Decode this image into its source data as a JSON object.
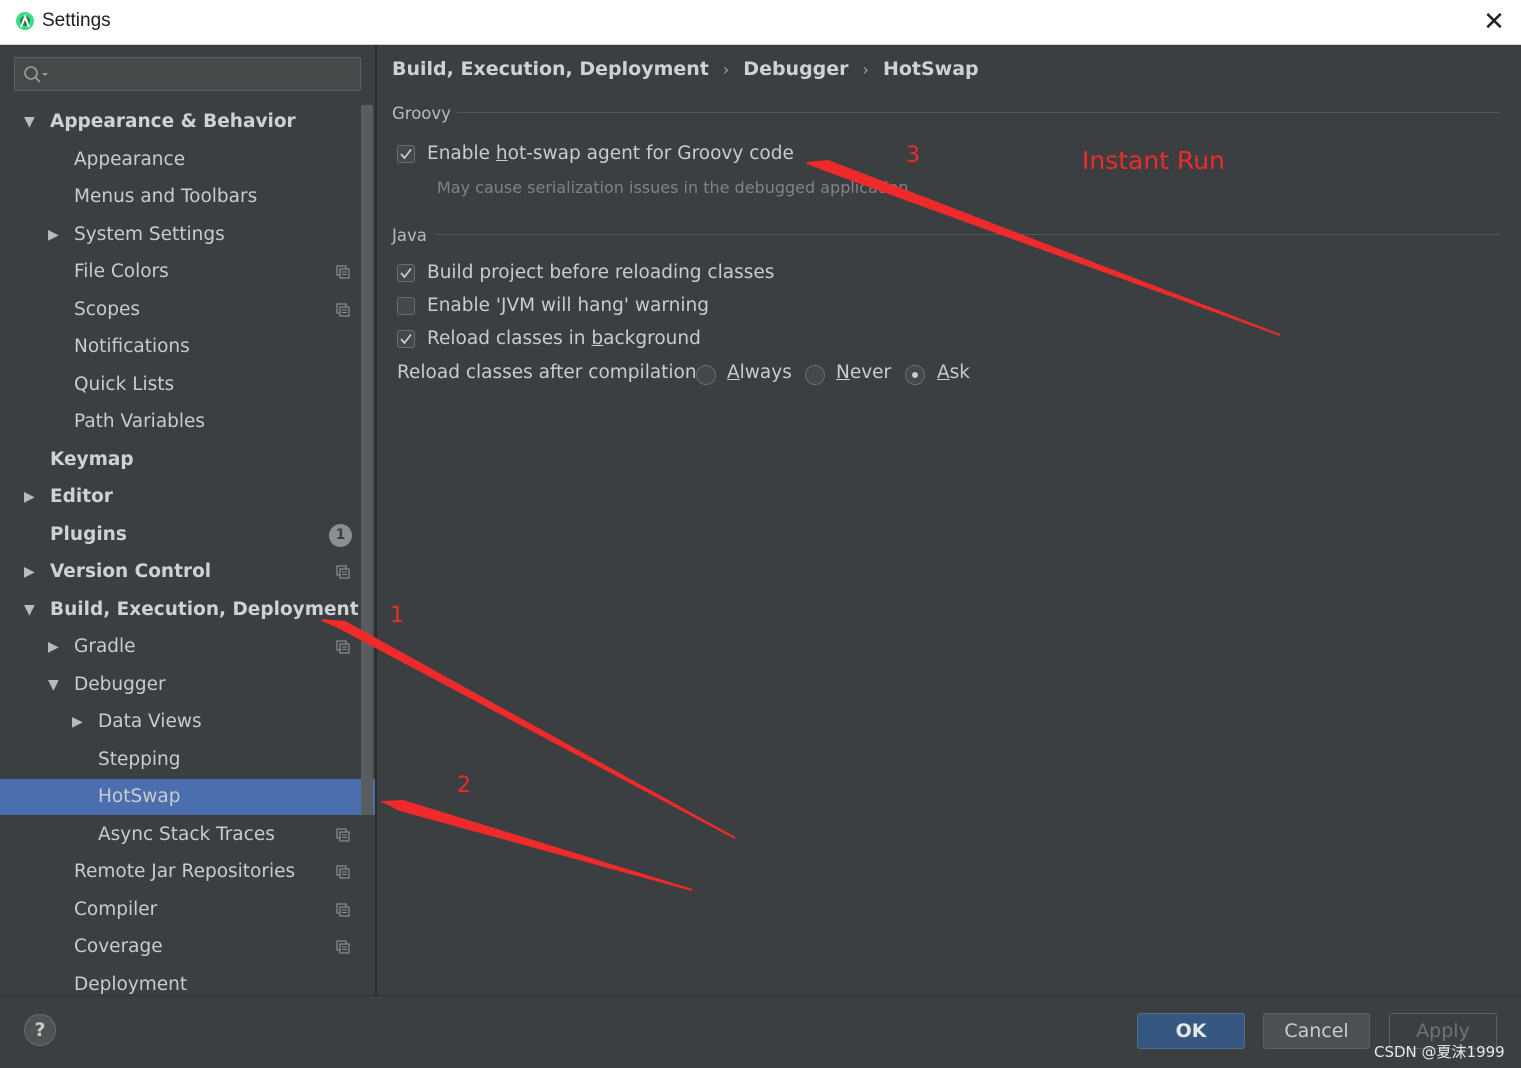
{
  "window": {
    "title": "Settings",
    "close_symbol": "✕"
  },
  "sidebar": {
    "search_placeholder": "",
    "items": [
      {
        "label": "Appearance & Behavior",
        "bold": true,
        "arrow": "down",
        "indent": 0
      },
      {
        "label": "Appearance",
        "indent": 1
      },
      {
        "label": "Menus and Toolbars",
        "indent": 1
      },
      {
        "label": "System Settings",
        "arrow": "right",
        "indent": 1
      },
      {
        "label": "File Colors",
        "indent": 1,
        "project_icon": true
      },
      {
        "label": "Scopes",
        "indent": 1,
        "project_icon": true
      },
      {
        "label": "Notifications",
        "indent": 1
      },
      {
        "label": "Quick Lists",
        "indent": 1
      },
      {
        "label": "Path Variables",
        "indent": 1
      },
      {
        "label": "Keymap",
        "bold": true,
        "indent": 0
      },
      {
        "label": "Editor",
        "bold": true,
        "arrow": "right",
        "indent": 0
      },
      {
        "label": "Plugins",
        "bold": true,
        "indent": 0,
        "badge": "1"
      },
      {
        "label": "Version Control",
        "bold": true,
        "arrow": "right",
        "indent": 0,
        "project_icon": true
      },
      {
        "label": "Build, Execution, Deployment",
        "bold": true,
        "arrow": "down",
        "indent": 0
      },
      {
        "label": "Gradle",
        "arrow": "right",
        "indent": 1,
        "project_icon": true
      },
      {
        "label": "Debugger",
        "arrow": "down",
        "indent": 1
      },
      {
        "label": "Data Views",
        "arrow": "right",
        "indent": 2
      },
      {
        "label": "Stepping",
        "indent": 2
      },
      {
        "label": "HotSwap",
        "indent": 2,
        "selected": true
      },
      {
        "label": "Async Stack Traces",
        "indent": 2,
        "project_icon": true
      },
      {
        "label": "Remote Jar Repositories",
        "indent": 1,
        "project_icon": true
      },
      {
        "label": "Compiler",
        "indent": 1,
        "project_icon": true
      },
      {
        "label": "Coverage",
        "indent": 1,
        "project_icon": true
      },
      {
        "label": "Deployment",
        "indent": 1
      }
    ]
  },
  "breadcrumb": [
    "Build, Execution, Deployment",
    "Debugger",
    "HotSwap"
  ],
  "breadcrumb_separator": "›",
  "groovy": {
    "title": "Groovy",
    "enable_agent": {
      "before": "Enable ",
      "mnemonic": "h",
      "after": "ot-swap agent for Groovy code",
      "checked": true
    },
    "hint": "May cause serialization issues in the debugged application"
  },
  "java": {
    "title": "Java",
    "build_before": {
      "label": "Build project before reloading classes",
      "checked": true
    },
    "jvm_hang": {
      "label": "Enable 'JVM will hang' warning",
      "checked": false
    },
    "reload_bg": {
      "before": "Reload classes in ",
      "mnemonic": "b",
      "after": "ackground",
      "checked": true
    },
    "reload_after": {
      "label": "Reload classes after compilation:",
      "options": [
        {
          "mnemonic": "A",
          "rest": "lways",
          "selected": false
        },
        {
          "mnemonic": "N",
          "rest": "ever",
          "selected": false
        },
        {
          "mnemonic": "A",
          "rest": "sk",
          "selected": true
        }
      ]
    }
  },
  "annotations": {
    "num1": "1",
    "num2": "2",
    "num3": "3",
    "instant_run": "Instant Run",
    "color": "#ee2a2a"
  },
  "footer": {
    "help": "?",
    "ok": "OK",
    "cancel": "Cancel",
    "apply": "Apply",
    "watermark": "CSDN @夏沫1999"
  }
}
